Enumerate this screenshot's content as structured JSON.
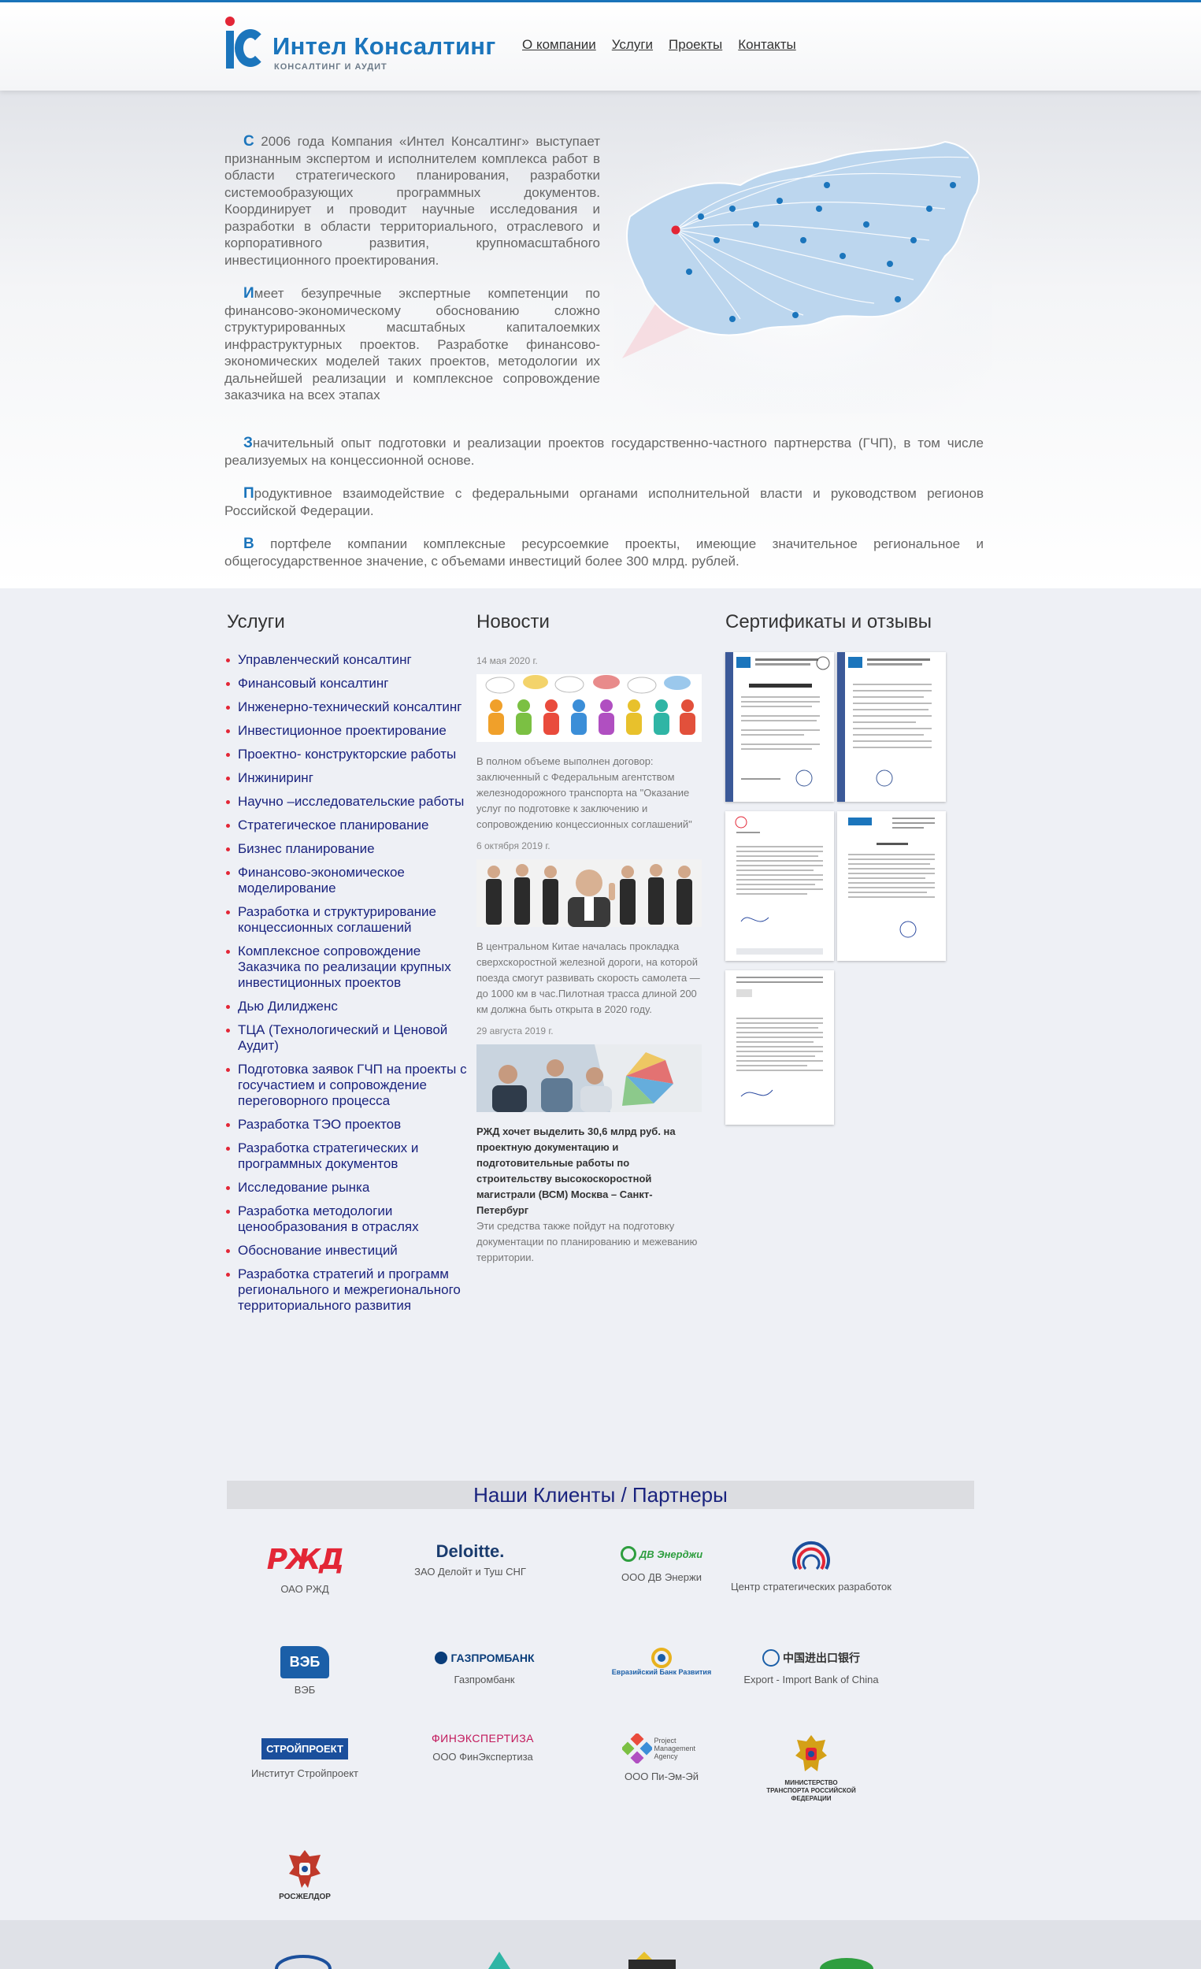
{
  "header": {
    "logo_name": "Интел Консалтинг",
    "logo_sub": "КОНСАЛТИНГ И АУДИТ",
    "nav": [
      "О компании",
      "Услуги",
      "Проекты",
      "Контакты"
    ]
  },
  "intro": {
    "p1_cap": "С",
    "p1": " 2006 года Компания «Интел Консалтинг» выступает признанным экспертом и исполнителем комплекса работ в области стратегического планирования, разработки системообразующих программных документов. Координирует и проводит научные исследования и разработки в области территориального, отраслевого и корпоративного развития, крупномасштабного инвестиционного проектирования.",
    "p2_cap": "И",
    "p2": "меет безупречные экспертные компетенции по финансово-экономическому обоснованию сложно структурированных масштабных капиталоемких инфраструктурных проектов. Разработке финансово-экономических моделей таких проектов, методологии их дальнейшей реализации и комплексное сопровождение заказчика на всех этапах",
    "p3_cap": "З",
    "p3": "начительный опыт подготовки и реализации проектов государственно-частного партнерства (ГЧП), в том числе реализуемых на концессионной основе.",
    "p4_cap": "П",
    "p4": "родуктивное взаимодействие с федеральными органами исполнительной власти и руководством регионов Российской Федерации.",
    "p5_cap": "В",
    "p5": " портфеле компании комплексные ресурсоемкие проекты, имеющие значительное региональное и общегосударственное значение, с объемами инвестиций более 300 млрд. рублей."
  },
  "columns": {
    "services_title": "Услуги",
    "news_title": "Новости",
    "certs_title": "Сертификаты и отзывы"
  },
  "services": [
    "Управленческий консалтинг",
    "Финансовый консалтинг",
    "Инженерно-технический консалтинг",
    "Инвестиционное проектирование",
    "Проектно- конструкторские работы",
    "Инжиниринг",
    "Научно –исследовательские работы",
    "Стратегическое планирование",
    "Бизнес планирование",
    "Финансово-экономическое моделирование",
    "Разработка и структурирование концессионных соглашений",
    "Комплексное сопровождение Заказчика по реализации крупных инвестиционных проектов",
    "Дью Дилидженс",
    "ТЦА (Технологический и Ценовой Аудит)",
    "Подготовка заявок ГЧП на проекты с госучастием и сопровождение переговорного процесса",
    "Разработка ТЭО проектов",
    "Разработка стратегических и программных документов",
    "Исследование рынка",
    "Разработка методологии ценообразования в отраслях",
    "Обоснование инвестиций",
    "Разработка стратегий и программ регионального и межрегионального территориального развития"
  ],
  "news": [
    {
      "date": "14 мая 2020 г.",
      "text": "В полном объеме выполнен договор: заключенный с Федеральным агентством железнодорожного транспорта на \"Оказание услуг по подготовке к заключению и сопровождению концессионных соглашений\""
    },
    {
      "date": "6 октября 2019 г.",
      "text": "В центральном Китае началась прокладка сверхскоростной железной дороги, на которой поезда смогут развивать скорость самолета — до 1000 км в час.Пилотная трасса длиной 200 км должна быть открыта в 2020 году."
    },
    {
      "date": "29 августа 2019 г.",
      "bold": "РЖД хочет выделить 30,6 млрд руб. на проектную документацию и подготовительные работы по строительству высокоскоростной магистрали (ВСМ) Москва – Санкт-Петербург",
      "text": "Эти средства также пойдут на подготовку документации по планированию и межеванию территории."
    }
  ],
  "clients": {
    "title": "Наши Клиенты / Партнеры",
    "items": [
      {
        "name": "ОАО РЖД",
        "logo": "РЖД"
      },
      {
        "name": "ЗАО Делойт и Туш СНГ",
        "logo": "Deloitte."
      },
      {
        "name": "ООО ДВ Энержи",
        "logo": "ДВ Энерджи"
      },
      {
        "name": "Центр стратегических разработок",
        "logo": ""
      },
      {
        "name": "ВЭБ",
        "logo": "ВЭБ"
      },
      {
        "name": "Газпромбанк",
        "logo": "ГАЗПРОМБАНК"
      },
      {
        "name": "",
        "logo": "Евразийский Банк Развития"
      },
      {
        "name": "Export - Import Bank of China",
        "logo": "中国进出口银行"
      },
      {
        "name": "Институт Стройпроект",
        "logo": "СТРОЙПРОЕКТ"
      },
      {
        "name": "ООО ФинЭкспертиза",
        "logo": "ФИНЭКСПЕРТИЗА"
      },
      {
        "name": "ООО Пи-Эм-Эй",
        "logo": "Project Management Agency"
      },
      {
        "name": "",
        "logo": "МИНИСТЕРСТВО ТРАНСПОРТА РОССИЙСКОЙ ФЕДЕРАЦИИ"
      },
      {
        "name": "",
        "logo": "РОСЖЕЛДОР"
      }
    ]
  },
  "colors": {
    "brand_blue": "#1b75bc",
    "accent_red": "#e32636",
    "link_navy": "#1a237e"
  }
}
